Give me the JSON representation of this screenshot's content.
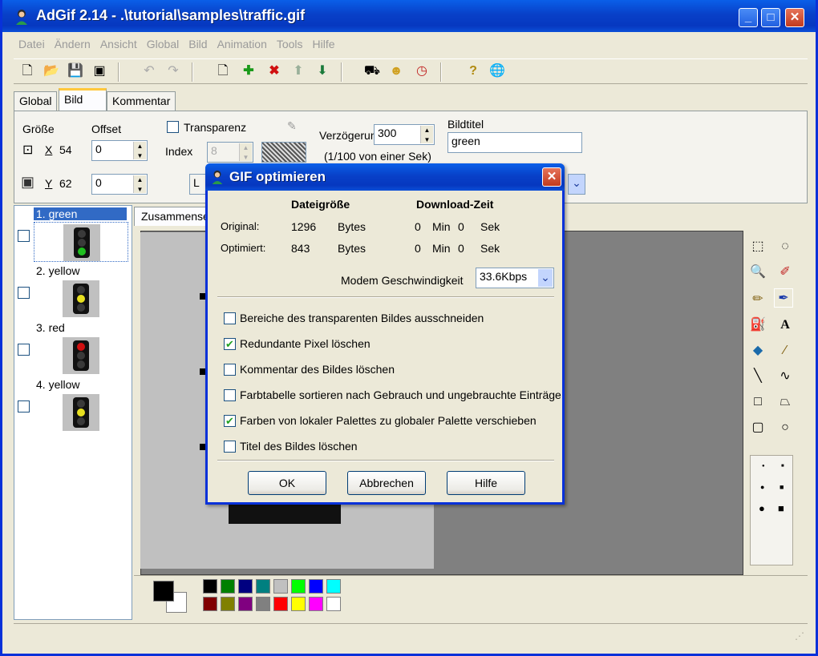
{
  "window": {
    "title": "AdGif 2.14 - .\\tutorial\\samples\\traffic.gif",
    "minimize": "_",
    "maximize": "□",
    "close": "✕"
  },
  "menu": [
    "Datei",
    "Ändern",
    "Ansicht",
    "Global",
    "Bild",
    "Animation",
    "Tools",
    "Hilfe"
  ],
  "tabs": [
    "Global",
    "Bild",
    "Kommentar"
  ],
  "bild_panel": {
    "groesse_label": "Größe",
    "offset_label": "Offset",
    "x_label": "X",
    "x_value": "54",
    "y_label": "Y",
    "y_value": "62",
    "offset_x": "0",
    "offset_y": "0",
    "transparenz_label": "Transparenz",
    "index_label": "Index",
    "index_value": "8",
    "button_partial": "L",
    "verzoegerung_label": "Verzögerung",
    "verzoegerung_value": "300",
    "verzoegerung_unit": "(1/100 von einer Sek)",
    "bildtitel_label": "Bildtitel",
    "bildtitel_value": "green"
  },
  "frames": [
    {
      "label": "1. green",
      "selected": true,
      "lit": "green"
    },
    {
      "label": "2. yellow",
      "selected": false,
      "lit": "yellow"
    },
    {
      "label": "3. red",
      "selected": false,
      "lit": "red"
    },
    {
      "label": "4. yellow",
      "selected": false,
      "lit": "yellow"
    }
  ],
  "subtab": "Zusammense",
  "dialog": {
    "title": "GIF optimieren",
    "col_filesize": "Dateigröße",
    "col_download": "Download-Zeit",
    "original_label": "Original:",
    "original_size": "1296",
    "original_unit": "Bytes",
    "original_min": "0",
    "original_sec": "0",
    "optimiert_label": "Optimiert:",
    "optimiert_size": "843",
    "optimiert_unit": "Bytes",
    "optimiert_min": "0",
    "optimiert_sec": "0",
    "min_label": "Min",
    "sek_label": "Sek",
    "modem_label": "Modem Geschwindigkeit",
    "modem_value": "33.6Kbps",
    "options": [
      {
        "label": "Bereiche des transparenten Bildes ausschneiden",
        "checked": false
      },
      {
        "label": "Redundante Pixel löschen",
        "checked": true
      },
      {
        "label": "Kommentar des Bildes löschen",
        "checked": false
      },
      {
        "label": "Farbtabelle sortieren nach Gebrauch und ungebrauchte Einträge",
        "checked": false
      },
      {
        "label": "Farben von lokaler Palettes zu globaler Palette verschieben",
        "checked": true
      },
      {
        "label": "Titel des Bildes löschen",
        "checked": false
      }
    ],
    "ok": "OK",
    "cancel": "Abbrechen",
    "help": "Hilfe"
  },
  "palette": [
    "#000000",
    "#008000",
    "#000080",
    "#008080",
    "#c0c0c0",
    "#00ff00",
    "#0000ff",
    "#00ffff",
    "#800000",
    "#808000",
    "#800080",
    "#808080",
    "#ff0000",
    "#ffff00",
    "#ff00ff",
    "#ffffff"
  ],
  "colors": {
    "titlebar": "#0840c8",
    "selection": "#316ac5",
    "green_lamp": "#1fbf1f",
    "yellow_lamp": "#e8e020",
    "red_lamp": "#d01010"
  }
}
